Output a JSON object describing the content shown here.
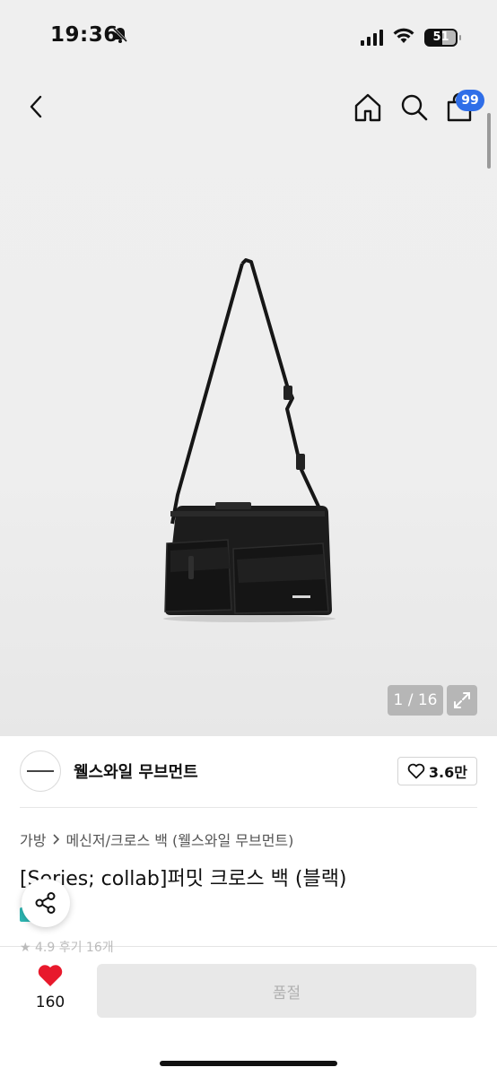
{
  "status_bar": {
    "time": "19:36",
    "battery_level": "51",
    "icons": [
      "bell-muted-icon",
      "signal-icon",
      "wifi-icon",
      "battery-icon"
    ]
  },
  "header": {
    "icons": [
      "back-icon",
      "home-icon",
      "search-icon",
      "cart-icon"
    ],
    "cart_badge": "99"
  },
  "gallery": {
    "counter": "1 / 16",
    "current_index": 1,
    "total": 16,
    "icons": [
      "expand-icon"
    ]
  },
  "brand": {
    "name": "웰스와일 무브먼트",
    "likes": "3.6만",
    "icons": [
      "brand-logo",
      "heart-outline-icon"
    ]
  },
  "breadcrumb": {
    "items": [
      "가방",
      "메신저/크로스 백 (웰스와일 무브먼트)"
    ]
  },
  "product": {
    "title": "[Series; collab]퍼밋 크로스 백 (블랙)",
    "rating_peek": "★ 4.9 후기 16개"
  },
  "actions": {
    "wish_count": "160",
    "soldout_label": "품절",
    "icons": [
      "share-icon",
      "heart-filled-icon"
    ]
  },
  "colors": {
    "accent": "#2f6ee8",
    "wish_heart": "#e8192c",
    "soldout_bg": "#e8e8e8",
    "hero_bg": "#efefef"
  }
}
